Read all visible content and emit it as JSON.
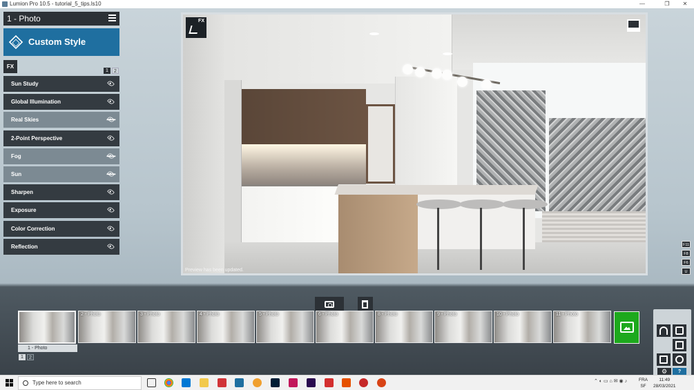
{
  "window": {
    "title": "Lumion Pro 10.5  -  tutorial_5_tips.ls10",
    "minimize": "—",
    "maximize": "❐",
    "close": "✕"
  },
  "left_panel": {
    "photo_header": "1 - Photo",
    "style_button": "Custom Style",
    "fx_tab": "FX",
    "effect_pages": [
      "1",
      "2"
    ],
    "effects": [
      {
        "label": "Sun Study",
        "visible": true
      },
      {
        "label": "Global Illumination",
        "visible": true
      },
      {
        "label": "Real Skies",
        "visible": false
      },
      {
        "label": "2-Point Perspective",
        "visible": true
      },
      {
        "label": "Fog",
        "visible": false
      },
      {
        "label": "Sun",
        "visible": false
      },
      {
        "label": "Sharpen",
        "visible": true
      },
      {
        "label": "Exposure",
        "visible": true
      },
      {
        "label": "Color Correction",
        "visible": true
      },
      {
        "label": "Reflection",
        "visible": true
      }
    ]
  },
  "viewport": {
    "fx_badge": "FX",
    "status": "Preview has been updated."
  },
  "shortcut_keys": [
    "F11",
    "F8",
    "F6",
    "U"
  ],
  "thumbnails": {
    "items": [
      "",
      "2 - Photo",
      "3 - Photo",
      "4 - Photo",
      "5 - Photo",
      "6 - Photo",
      "8 - Photo",
      "9 - Photo",
      "10 - Photo",
      "11 - Photo"
    ],
    "active_caption": "1 - Photo",
    "pages": [
      "1",
      "2"
    ]
  },
  "modes": {
    "help_label": "?",
    "settings_label": "⚙"
  },
  "taskbar": {
    "search_placeholder": "Type here to search",
    "lang_top": "FRA",
    "lang_bottom": "SF",
    "time": "11:49",
    "date": "28/03/2021"
  },
  "colors": {
    "accent_blue": "#1f6fa0",
    "render_green": "#1da91d",
    "dark_panel": "#2c3136"
  }
}
